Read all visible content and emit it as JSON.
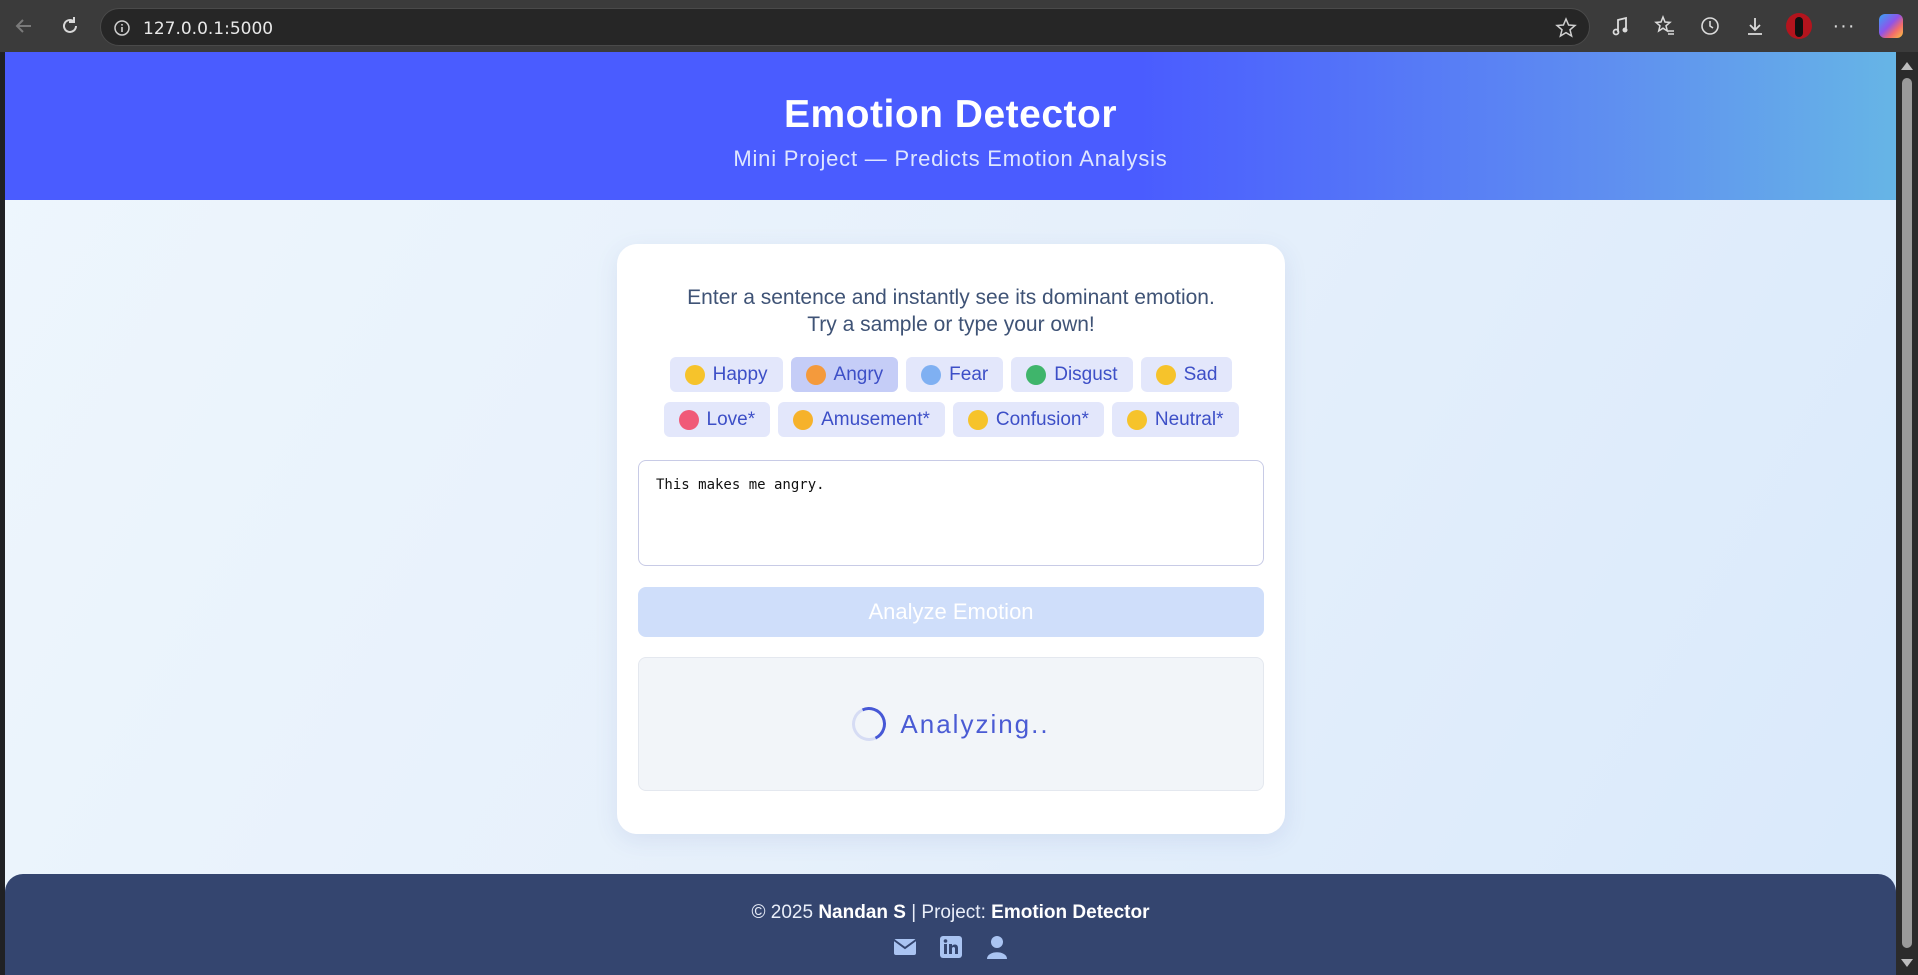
{
  "browser": {
    "url": "127.0.0.1:5000"
  },
  "header": {
    "title": "Emotion Detector",
    "subtitle": "Mini Project — Predicts Emotion Analysis"
  },
  "intro": {
    "line1": "Enter a sentence and instantly see its dominant emotion.",
    "line2": "Try a sample or type your own!"
  },
  "samples": [
    {
      "label": "Happy",
      "emoji_color": "#f6c32b",
      "active": false
    },
    {
      "label": "Angry",
      "emoji_color": "#f49a3c",
      "active": true
    },
    {
      "label": "Fear",
      "emoji_color": "#7fb0f2",
      "active": false
    },
    {
      "label": "Disgust",
      "emoji_color": "#3fb56b",
      "active": false
    },
    {
      "label": "Sad",
      "emoji_color": "#f6c32b",
      "active": false
    },
    {
      "label": "Love*",
      "emoji_color": "#f05a78",
      "active": false
    },
    {
      "label": "Amusement*",
      "emoji_color": "#f6b22b",
      "active": false
    },
    {
      "label": "Confusion*",
      "emoji_color": "#f6c32b",
      "active": false
    },
    {
      "label": "Neutral*",
      "emoji_color": "#f6c32b",
      "active": false
    }
  ],
  "input": {
    "value": "This makes me angry."
  },
  "analyze_button": {
    "label": "Analyze Emotion"
  },
  "result": {
    "status": "Analyzing.."
  },
  "footer": {
    "copyright": "© 2025",
    "author": "Nandan S",
    "separator": "| Project:",
    "project": "Emotion Detector",
    "icons": [
      "mail-icon",
      "linkedin-icon",
      "user-icon"
    ]
  },
  "colors": {
    "accent": "#4a5cff",
    "footer": "#34456f"
  }
}
